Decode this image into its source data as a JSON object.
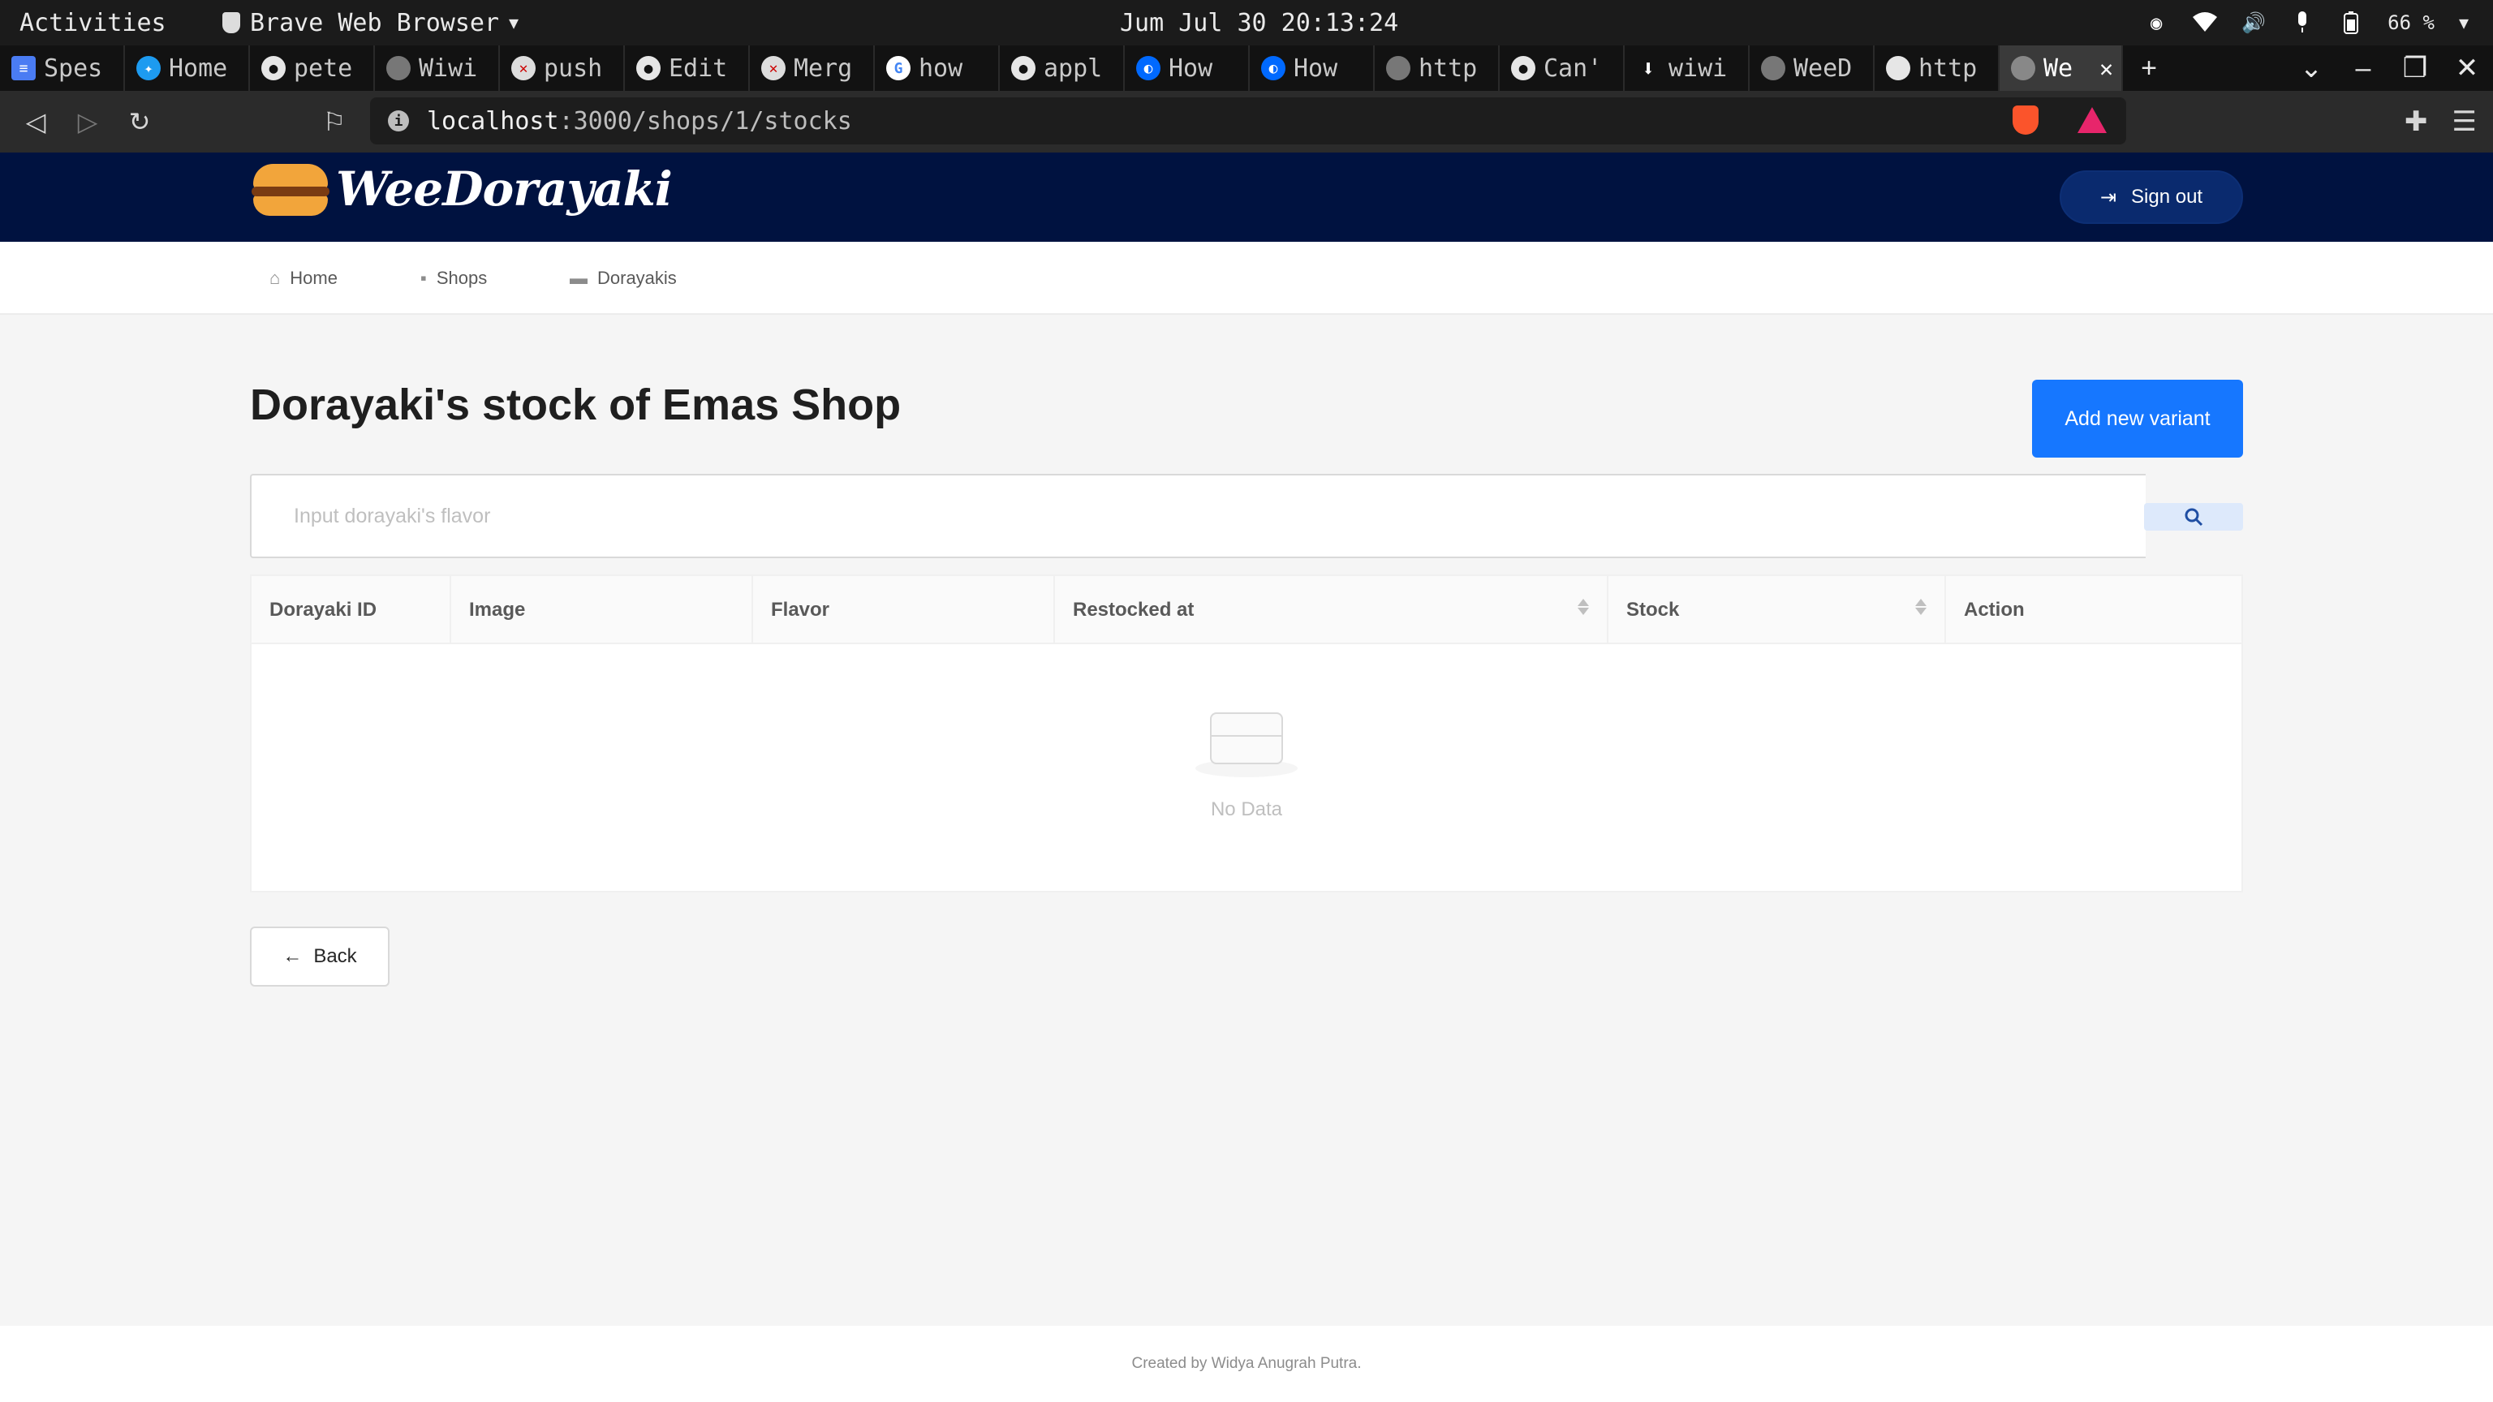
{
  "system": {
    "activities": "Activities",
    "browser_name": "Brave Web Browser",
    "clock": "Jum Jul 30 20:13:24",
    "battery": "66 %"
  },
  "tabs": [
    {
      "label": "Spes",
      "icon": "docs-icon"
    },
    {
      "label": "Home",
      "icon": "twitter-icon"
    },
    {
      "label": "pete",
      "icon": "github-icon"
    },
    {
      "label": "Wiwi",
      "icon": "globe-icon"
    },
    {
      "label": "push",
      "icon": "gitlab-error-icon"
    },
    {
      "label": "Edit",
      "icon": "github-icon"
    },
    {
      "label": "Merg",
      "icon": "gitlab-error-icon"
    },
    {
      "label": "how",
      "icon": "google-icon"
    },
    {
      "label": "appl",
      "icon": "github-icon"
    },
    {
      "label": "How",
      "icon": "digitalocean-icon"
    },
    {
      "label": "How",
      "icon": "digitalocean-icon"
    },
    {
      "label": "http",
      "icon": "globe-icon"
    },
    {
      "label": "Can'",
      "icon": "github-icon"
    },
    {
      "label": "wiwi",
      "icon": "download-icon"
    },
    {
      "label": "WeeD",
      "icon": "globe-icon"
    },
    {
      "label": "http",
      "icon": "globe-icon"
    },
    {
      "label": "We",
      "icon": "globe-icon",
      "active": true
    }
  ],
  "address": {
    "host": "localhost",
    "path": ":3000/shops/1/stocks"
  },
  "header": {
    "brand": "WeeDorayaki",
    "signout_label": "Sign out"
  },
  "menu": [
    {
      "label": "Home",
      "icon": "home-icon"
    },
    {
      "label": "Shops",
      "icon": "shop-icon"
    },
    {
      "label": "Dorayakis",
      "icon": "dorayaki-icon"
    }
  ],
  "main": {
    "title": "Dorayaki's stock of Emas Shop",
    "add_label": "Add new variant",
    "search_placeholder": "Input dorayaki's flavor",
    "columns": [
      "Dorayaki ID",
      "Image",
      "Flavor",
      "Restocked at",
      "Stock",
      "Action"
    ],
    "empty_text": "No Data",
    "back_label": "Back"
  },
  "footer": {
    "credit": "Created by Widya Anugrah Putra."
  },
  "colors": {
    "header_bg": "#001240",
    "primary": "#1677ff"
  }
}
